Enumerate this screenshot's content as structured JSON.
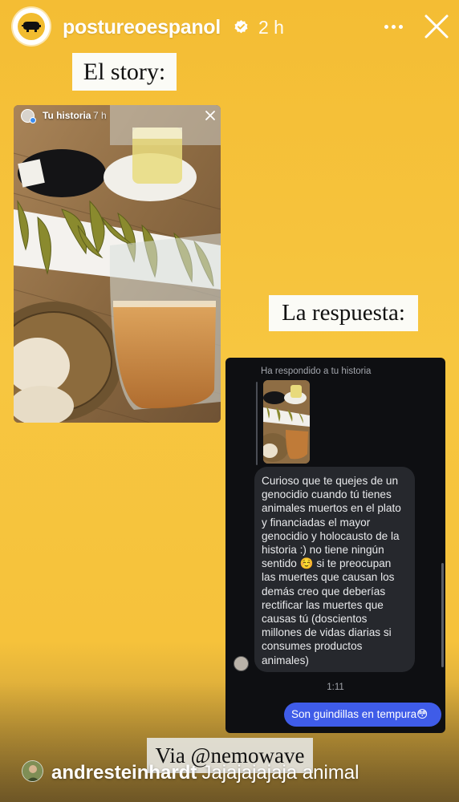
{
  "header": {
    "username": "postureoespanol",
    "time_ago": "2 h"
  },
  "labels": {
    "story": "El story:",
    "response": "La respuesta:",
    "via": "Via @nemowave"
  },
  "story_screenshot": {
    "name": "Tu historia",
    "time": "7 h"
  },
  "chat": {
    "reply_caption": "Ha respondido a tu historia",
    "incoming_message": "Curioso que te quejes de un genocidio cuando tú tienes animales muertos en el plato y financiadas el mayor genocidio y holocausto de la historia :) no tiene ningún sentido ☺️ si te preocupan las muertes que causan los demás creo que deberías rectificar las muertes que causas tú (doscientos millones de vidas diarias si consumes productos animales)",
    "timestamp": "1:11",
    "outgoing_message": "Son guindillas en tempura😳"
  },
  "comment": {
    "username": "andresteinhardt",
    "text": "Jajajajajaja animal"
  },
  "colors": {
    "background": "#f6c33e",
    "chat_background": "#0e0f12",
    "incoming_bubble": "#26282d",
    "outgoing_bubble": "#3f5ce8",
    "verified_badge": "#3897f0"
  },
  "icons": [
    "verified-badge-icon",
    "more-options-icon",
    "close-icon",
    "pig-logo-icon"
  ]
}
